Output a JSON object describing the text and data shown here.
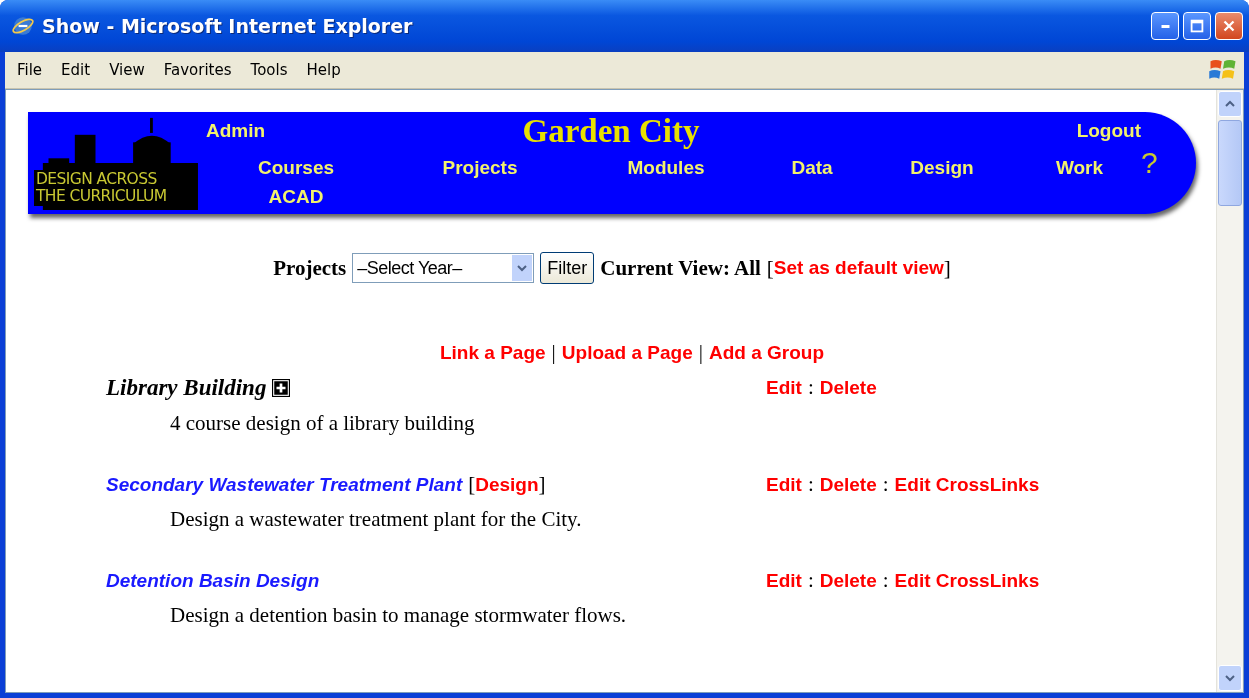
{
  "window": {
    "title": "Show - Microsoft Internet Explorer"
  },
  "menu_bar": [
    "File",
    "Edit",
    "View",
    "Favorites",
    "Tools",
    "Help"
  ],
  "banner": {
    "logo_text": [
      "DESIGN ACROSS",
      "THE CURRICULUM"
    ],
    "title": "Garden City",
    "top_left": "Admin",
    "top_right": "Logout",
    "help": "?",
    "nav": [
      {
        "label": "Courses",
        "sub": "ACAD"
      },
      {
        "label": "Projects"
      },
      {
        "label": "Modules"
      },
      {
        "label": "Data"
      },
      {
        "label": "Design"
      },
      {
        "label": "Work"
      }
    ]
  },
  "filter": {
    "label": "Projects",
    "select": {
      "value": "–Select Year–"
    },
    "button": "Filter",
    "current_view": "Current View: All",
    "brackets": [
      "[",
      "]"
    ],
    "default_link": "Set as default view"
  },
  "actions": {
    "links": [
      "Link a Page",
      "Upload a Page",
      "Add a Group"
    ],
    "separator": "|"
  },
  "items": [
    {
      "kind": "group",
      "title": "Library Building",
      "actions": [
        "Edit",
        "Delete"
      ],
      "description": "4 course design of a library building"
    },
    {
      "kind": "project",
      "title": "Secondary Wastewater Treatment Plant",
      "tag": "Design",
      "actions": [
        "Edit",
        "Delete",
        "Edit CrossLinks"
      ],
      "description": "Design a wastewater treatment plant for the City."
    },
    {
      "kind": "project",
      "title": "Detention Basin Design",
      "actions": [
        "Edit",
        "Delete",
        "Edit CrossLinks"
      ],
      "description": "Design a detention basin to manage stormwater flows."
    }
  ],
  "item_separator": ":"
}
